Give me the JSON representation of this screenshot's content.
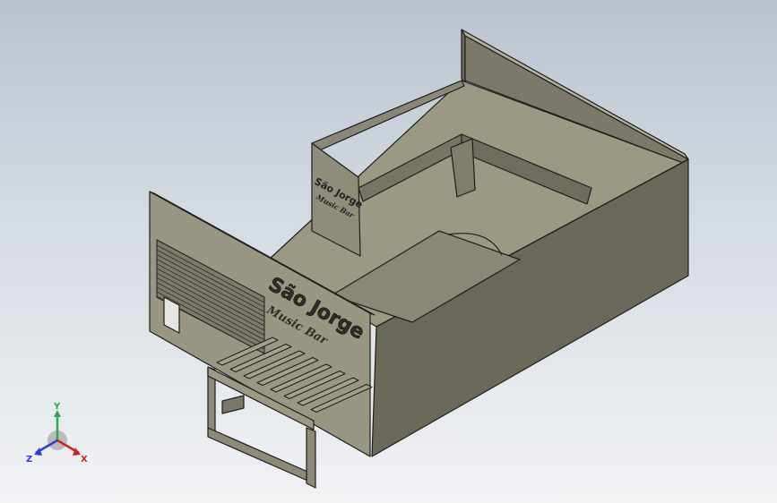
{
  "signs": {
    "front": {
      "title": "São Jorge",
      "subtitle": "Music Bar"
    },
    "back": {
      "title": "São Jorge",
      "subtitle": "Music Bar"
    }
  },
  "triad": {
    "x_label": "X",
    "y_label": "Y",
    "z_label": "Z"
  },
  "colors": {
    "wall_light": "#8f8c7a",
    "wall_dark": "#5f5d50",
    "floor": "#9b9884",
    "edge": "#1e1e1a",
    "x_axis": "#d42020",
    "y_axis": "#2aa84a",
    "z_axis": "#2b3fd6"
  }
}
